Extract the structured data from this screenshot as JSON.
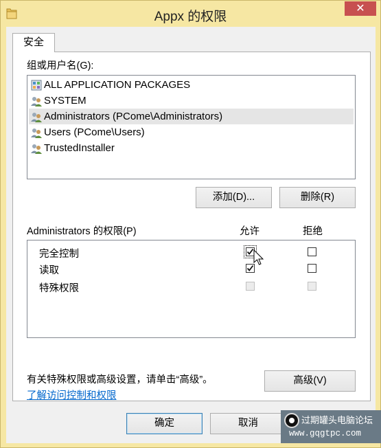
{
  "window": {
    "title": "Appx 的权限",
    "close_glyph": "✕"
  },
  "tab": {
    "label": "安全"
  },
  "group_label": "组或用户名(G):",
  "principals": [
    {
      "name": "ALL APPLICATION PACKAGES",
      "icon": "app-packages-icon",
      "selected": false
    },
    {
      "name": "SYSTEM",
      "icon": "user-group-icon",
      "selected": false
    },
    {
      "name": "Administrators (PCome\\Administrators)",
      "icon": "user-group-icon",
      "selected": true
    },
    {
      "name": "Users (PCome\\Users)",
      "icon": "user-group-icon",
      "selected": false
    },
    {
      "name": "TrustedInstaller",
      "icon": "user-group-icon",
      "selected": false
    }
  ],
  "buttons": {
    "add": "添加(D)...",
    "remove": "删除(R)",
    "advanced": "高级(V)",
    "ok": "确定",
    "cancel": "取消"
  },
  "permissions": {
    "header": "Administrators 的权限(P)",
    "allow_header": "允许",
    "deny_header": "拒绝",
    "rows": [
      {
        "label": "完全控制",
        "allow": true,
        "deny": false,
        "enabled": true
      },
      {
        "label": "读取",
        "allow": true,
        "deny": false,
        "enabled": true
      },
      {
        "label": "特殊权限",
        "allow": false,
        "deny": false,
        "enabled": false
      }
    ]
  },
  "advanced_note": "有关特殊权限或高级设置，请单击“高级”。",
  "help_link": "了解访问控制和权限",
  "watermark": {
    "name": "过期罐头电脑论坛",
    "url": "www.gqgtpc.com"
  },
  "colors": {
    "title_bar": "#f6e7a3",
    "close_button": "#c75050",
    "link": "#0066cc",
    "selected_row": "#e5e5e5"
  }
}
